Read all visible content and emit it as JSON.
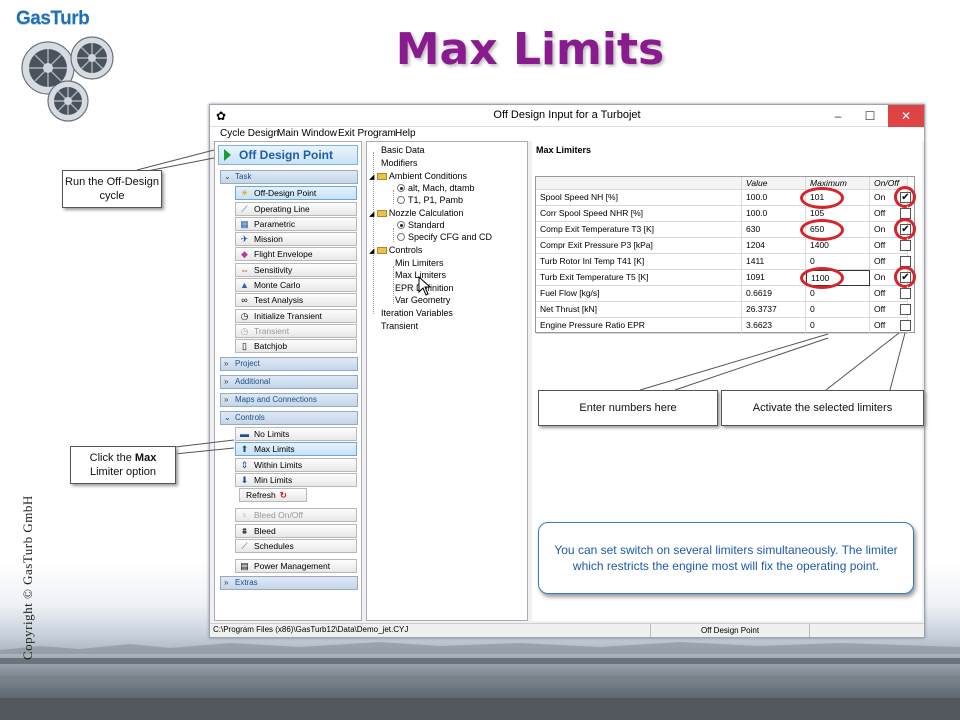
{
  "slide": {
    "title": "Max Limits",
    "logo": "GasTurb",
    "copyright": "Copyright © GasTurb GmbH"
  },
  "window": {
    "title": "Off Design Input for a Turbojet",
    "menu": [
      "Cycle Design",
      "Main Window",
      "Exit Program",
      "Help"
    ],
    "status_path": "C:\\Program Files (x86)\\GasTurb12\\Data\\Demo_jet.CYJ",
    "status_mode": "Off Design Point"
  },
  "left_panel": {
    "header_button": "Off Design Point",
    "sections": {
      "task": "Task",
      "project": "Project",
      "additional": "Additional",
      "maps": "Maps and Connections",
      "controls": "Controls",
      "extras": "Extras"
    },
    "task_items": [
      "Off-Design Point",
      "Operating Line",
      "Parametric",
      "Mission",
      "Flight Envelope",
      "Sensitivity",
      "Monte Carlo",
      "Test Analysis",
      "Initialize Transient",
      "Transient",
      "Batchjob"
    ],
    "control_items": [
      "No Limits",
      "Max Limits",
      "Within Limits",
      "Min Limits"
    ],
    "refresh": "Refresh",
    "extra_items": [
      "Bleed On/Off",
      "Bleed",
      "Schedules",
      "Power Management"
    ]
  },
  "tree": {
    "basic_data": "Basic Data",
    "modifiers": "Modifiers",
    "ambient": "Ambient Conditions",
    "ambient_opt1": "alt, Mach, dtamb",
    "ambient_opt2": "T1, P1, Pamb",
    "nozzle": "Nozzle Calculation",
    "nozzle_opt1": "Standard",
    "nozzle_opt2": "Specify CFG and CD",
    "controls": "Controls",
    "min_limiters": "Min Limiters",
    "max_limiters": "Max Limiters",
    "epr_definition": "EPR Definition",
    "var_geometry": "Var Geometry",
    "iteration": "Iteration Variables",
    "transient": "Transient"
  },
  "limiters": {
    "heading": "Max Limiters",
    "columns": [
      "",
      "Value",
      "Maximum",
      "On/Off"
    ],
    "rows": [
      {
        "name": "Spool Speed NH [%]",
        "value": "100.0",
        "maximum": "101",
        "state": "On",
        "checked": true
      },
      {
        "name": "Corr Spool Speed NHR [%]",
        "value": "100.0",
        "maximum": "105",
        "state": "Off",
        "checked": false
      },
      {
        "name": "Comp Exit Temperature T3 [K]",
        "value": "630",
        "maximum": "650",
        "state": "On",
        "checked": true
      },
      {
        "name": "Compr Exit Pressure P3 [kPa]",
        "value": "1204",
        "maximum": "1400",
        "state": "Off",
        "checked": false
      },
      {
        "name": "Turb Rotor Inl Temp T41 [K]",
        "value": "1411",
        "maximum": "0",
        "state": "Off",
        "checked": false
      },
      {
        "name": "Turb Exit Temperature T5 [K]",
        "value": "1091",
        "maximum": "1100",
        "state": "On",
        "checked": true
      },
      {
        "name": "Fuel Flow [kg/s]",
        "value": "0.6619",
        "maximum": "0",
        "state": "Off",
        "checked": false
      },
      {
        "name": "Net Thrust [kN]",
        "value": "26.3737",
        "maximum": "0",
        "state": "Off",
        "checked": false
      },
      {
        "name": "Engine Pressure Ratio EPR",
        "value": "3.6623",
        "maximum": "0",
        "state": "Off",
        "checked": false
      }
    ]
  },
  "callouts": {
    "run": "Run the Off-Design cycle",
    "click_pre": "Click the ",
    "click_bold": "Max",
    "click_post": " Limiter option",
    "enter": "Enter numbers here",
    "activate": "Activate the selected limiters",
    "note": "You can set switch on several limiters simultaneously. The limiter which restricts the engine most will fix the operating point."
  },
  "icons": [
    "fan-logo-icon",
    "play-arrow-icon",
    "chevron-icon",
    "folder-icon",
    "radio-icon",
    "checkbox-icon",
    "cursor-icon"
  ],
  "colors": {
    "title": "#8a1b8f",
    "accent": "#1d5ea8",
    "highlight_ring": "#d9232a",
    "note_text": "#1e5aa8"
  }
}
